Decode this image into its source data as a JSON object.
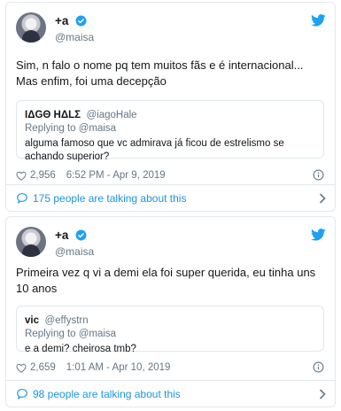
{
  "colors": {
    "link": "#1b95e0",
    "muted": "#657786",
    "text": "#14171a",
    "border": "#e1e8ed"
  },
  "tweets": [
    {
      "display_name": "+a",
      "handle": "@maisa",
      "text": "Sim, n falo o nome pq tem muitos fãs e é internacional... Mas enfim, foi uma decepção",
      "quoted": {
        "name": "ΙΔGΘ HΔLΣ",
        "handle": "@iagoHale",
        "replying_to": "Replying to @maisa",
        "text": "alguma famoso que vc admirava já ficou de estrelismo se achando superior?"
      },
      "likes": "2,956",
      "timestamp": "6:52 PM - Apr 9, 2019",
      "talking": "175 people are talking about this"
    },
    {
      "display_name": "+a",
      "handle": "@maisa",
      "text": "Primeira vez q vi a demi ela foi super querida, eu tinha uns 10 anos",
      "quoted": {
        "name": "vic",
        "handle": "@effystrn",
        "replying_to": "Replying to @maisa",
        "text": "e a demi? cheirosa tmb?"
      },
      "likes": "2,659",
      "timestamp": "1:01 AM - Apr 10, 2019",
      "talking": "98 people are talking about this"
    }
  ],
  "icons": [
    "avatar",
    "verified-badge-icon",
    "twitter-bird-icon",
    "heart-icon",
    "info-icon",
    "comment-bubble-icon",
    "chevron-right-icon"
  ]
}
